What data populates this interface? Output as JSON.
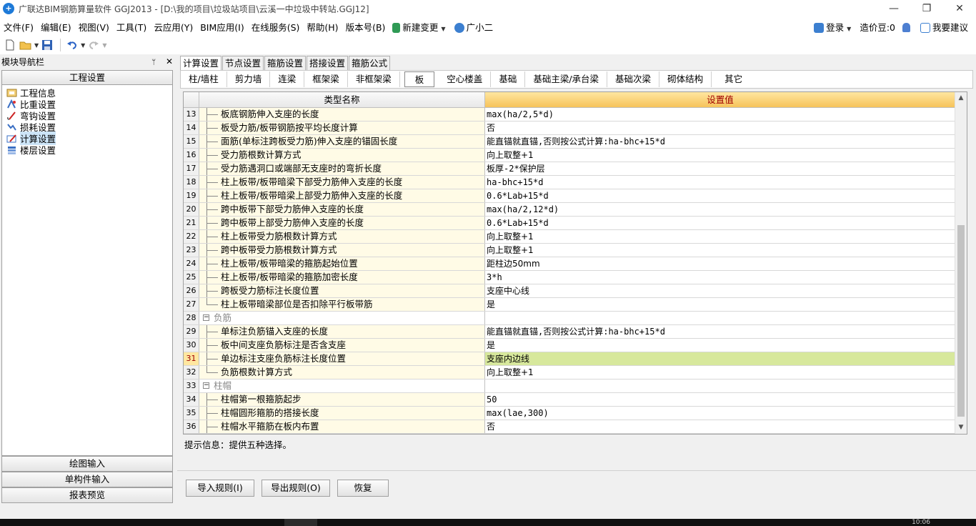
{
  "window": {
    "title": "广联达BIM钢筋算量软件 GGJ2013 - [D:\\我的项目\\垃圾站项目\\云溪一中垃圾中转站.GGJ12]",
    "minimize": "—",
    "restore": "❐",
    "close": "✕"
  },
  "menu": {
    "items": [
      "文件(F)",
      "编辑(E)",
      "视图(V)",
      "工具(T)",
      "云应用(Y)",
      "BIM应用(I)",
      "在线服务(S)",
      "帮助(H)",
      "版本号(B)"
    ],
    "new_change": "新建变更",
    "guangxiaoer": "广小二",
    "login": "登录",
    "zaojiadou": "造价豆:0",
    "suggest": "我要建议"
  },
  "left_panel": {
    "header": "模块导航栏",
    "pin": "ᛘ",
    "close": "✕",
    "section": "工程设置",
    "tree": [
      {
        "label": "工程信息"
      },
      {
        "label": "比重设置"
      },
      {
        "label": "弯钩设置"
      },
      {
        "label": "损耗设置"
      },
      {
        "label": "计算设置"
      },
      {
        "label": "楼层设置"
      }
    ],
    "bottom": [
      "绘图输入",
      "单构件输入",
      "报表预览"
    ]
  },
  "tabs_main": [
    "计算设置",
    "节点设置",
    "箍筋设置",
    "搭接设置",
    "箍筋公式"
  ],
  "tabs_sub": [
    "柱/墙柱",
    "剪力墙",
    "连梁",
    "框架梁",
    "非框架梁",
    "板",
    "空心楼盖",
    "基础",
    "基础主梁/承台梁",
    "基础次梁",
    "砌体结构",
    "其它"
  ],
  "grid": {
    "col_name": "类型名称",
    "col_value": "设置值",
    "rows": [
      {
        "n": "13",
        "name": "板底钢筋伸入支座的长度",
        "value": "max(ha/2,5*d)"
      },
      {
        "n": "14",
        "name": "板受力筋/板带钢筋按平均长度计算",
        "value": "否"
      },
      {
        "n": "15",
        "name": "面筋(单标注跨板受力筋)伸入支座的锚固长度",
        "value": "能直锚就直锚,否则按公式计算:ha-bhc+15*d"
      },
      {
        "n": "16",
        "name": "受力筋根数计算方式",
        "value": "向上取整+1"
      },
      {
        "n": "17",
        "name": "受力筋遇洞口或端部无支座时的弯折长度",
        "value": "板厚-2*保护层"
      },
      {
        "n": "18",
        "name": "柱上板带/板带暗梁下部受力筋伸入支座的长度",
        "value": "ha-bhc+15*d"
      },
      {
        "n": "19",
        "name": "柱上板带/板带暗梁上部受力筋伸入支座的长度",
        "value": "0.6*Lab+15*d"
      },
      {
        "n": "20",
        "name": "跨中板带下部受力筋伸入支座的长度",
        "value": "max(ha/2,12*d)"
      },
      {
        "n": "21",
        "name": "跨中板带上部受力筋伸入支座的长度",
        "value": "0.6*Lab+15*d"
      },
      {
        "n": "22",
        "name": "柱上板带受力筋根数计算方式",
        "value": "向上取整+1"
      },
      {
        "n": "23",
        "name": "跨中板带受力筋根数计算方式",
        "value": "向上取整+1"
      },
      {
        "n": "24",
        "name": "柱上板带/板带暗梁的箍筋起始位置",
        "value": "距柱边50mm"
      },
      {
        "n": "25",
        "name": "柱上板带/板带暗梁的箍筋加密长度",
        "value": "3*h"
      },
      {
        "n": "26",
        "name": "跨板受力筋标注长度位置",
        "value": "支座中心线"
      },
      {
        "n": "27",
        "name": "柱上板带暗梁部位是否扣除平行板带筋",
        "value": "是"
      },
      {
        "n": "28",
        "name": "负筋",
        "value": "",
        "group": true
      },
      {
        "n": "29",
        "name": "单标注负筋锚入支座的长度",
        "value": "能直锚就直锚,否则按公式计算:ha-bhc+15*d"
      },
      {
        "n": "30",
        "name": "板中间支座负筋标注是否含支座",
        "value": "是"
      },
      {
        "n": "31",
        "name": "单边标注支座负筋标注长度位置",
        "value": "支座内边线",
        "selected": true
      },
      {
        "n": "32",
        "name": "负筋根数计算方式",
        "value": "向上取整+1"
      },
      {
        "n": "33",
        "name": "柱帽",
        "value": "",
        "group": true
      },
      {
        "n": "34",
        "name": "柱帽第一根箍筋起步",
        "value": "50"
      },
      {
        "n": "35",
        "name": "柱帽圆形箍筋的搭接长度",
        "value": "max(lae,300)"
      },
      {
        "n": "36",
        "name": "柱帽水平箍筋在板内布置",
        "value": "否"
      }
    ]
  },
  "hint": "提示信息：提供五种选择。",
  "buttons": {
    "import": "导入规则(I)",
    "export": "导出规则(O)",
    "restore": "恢复"
  },
  "taskbar": {
    "clock": "10:06"
  }
}
